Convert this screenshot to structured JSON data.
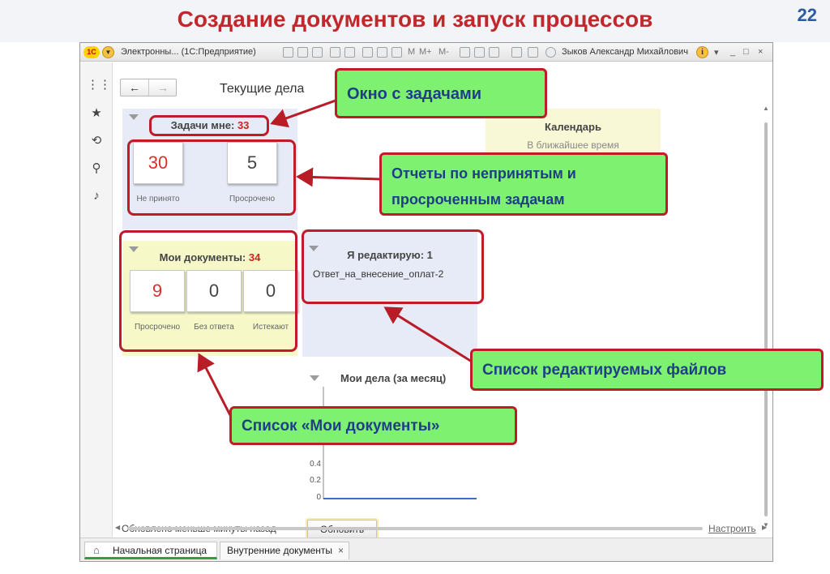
{
  "slide": {
    "title": "Создание документов и запуск процессов",
    "number": "22"
  },
  "titlebar": {
    "logo": "1С",
    "app_title": "Электронны...  (1С:Предприятие)",
    "m_labels": [
      "M",
      "M+",
      "M-"
    ],
    "user": "Зыков Александр Михайлович",
    "info": "i",
    "window_controls": [
      "_",
      "□",
      "×"
    ]
  },
  "sidebar": {
    "icons": [
      "apps-grid-icon",
      "star-icon",
      "history-icon",
      "search-icon",
      "bell-icon"
    ]
  },
  "nav": {
    "back": "←",
    "forward": "→",
    "page_title": "Текущие дела"
  },
  "tasks": {
    "heading": "Задачи мне:",
    "count": "33",
    "tiles": [
      {
        "value": "30",
        "caption": "Не принято"
      },
      {
        "value": "5",
        "caption": "Просрочено"
      }
    ]
  },
  "calendar": {
    "heading": "Календарь",
    "subtitle": "В ближайшее время"
  },
  "my_docs": {
    "heading": "Мои документы:",
    "count": "34",
    "tiles": [
      {
        "value": "9",
        "caption": "Просрочено"
      },
      {
        "value": "0",
        "caption": "Без ответа"
      },
      {
        "value": "0",
        "caption": "Истекают"
      }
    ]
  },
  "editing": {
    "heading": "Я редактирую: 1",
    "items": [
      "Ответ_на_внесение_оплат-2"
    ]
  },
  "my_month": {
    "heading": "Мои дела (за месяц)",
    "y_ticks": [
      "0.4",
      "0.2",
      "0"
    ]
  },
  "footer": {
    "updated": "Обновлено меньше минуты назад",
    "refresh_button": "Обновить",
    "settings_link": "Настроить"
  },
  "tabs": [
    {
      "label": "Начальная страница"
    },
    {
      "label": "Внутренние документы",
      "close": "×"
    }
  ],
  "callouts": {
    "tasks_window": "Окно с задачами",
    "reports_line1": "Отчеты по непринятым и",
    "reports_line2": "просроченным задачам",
    "edited_files": "Список редактируемых файлов",
    "my_docs_list": "Список «Мои документы»"
  },
  "colors": {
    "title_red": "#c0282c",
    "callout_green": "#7ef170",
    "callout_border": "#c01b28",
    "callout_text": "#1e3f86",
    "slide_number_blue": "#2d5aa0",
    "tab_accent": "#2e9e4a"
  }
}
